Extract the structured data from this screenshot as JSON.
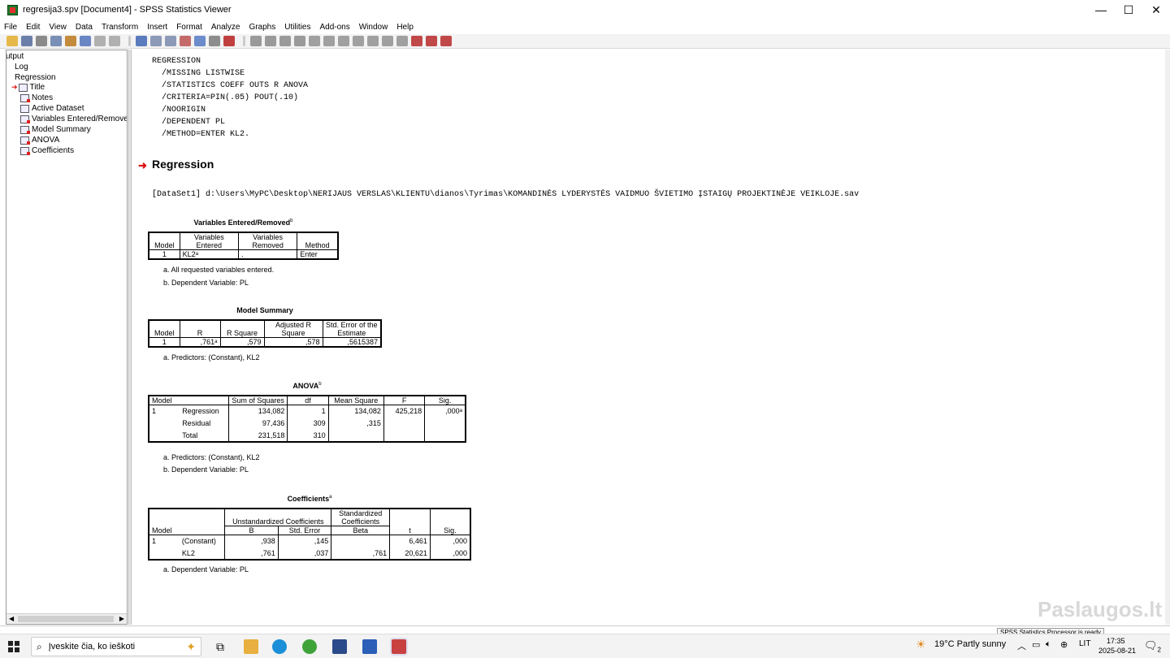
{
  "window": {
    "title": "regresija3.spv [Document4] - SPSS Statistics Viewer",
    "minimize": "—",
    "maximize": "☐",
    "close": "✕"
  },
  "menu": [
    "File",
    "Edit",
    "View",
    "Data",
    "Transform",
    "Insert",
    "Format",
    "Analyze",
    "Graphs",
    "Utilities",
    "Add-ons",
    "Window",
    "Help"
  ],
  "tree": {
    "output": "utput",
    "log": "Log",
    "regression": "Regression",
    "items": [
      "Title",
      "Notes",
      "Active Dataset",
      "Variables Entered/Removed",
      "Model Summary",
      "ANOVA",
      "Coefficients"
    ]
  },
  "syntax": "REGRESSION\n  /MISSING LISTWISE\n  /STATISTICS COEFF OUTS R ANOVA\n  /CRITERIA=PIN(.05) POUT(.10)\n  /NOORIGIN\n  /DEPENDENT PL\n  /METHOD=ENTER KL2.",
  "heading": "Regression",
  "dataset": "[DataSet1] d:\\Users\\MyPC\\Desktop\\NERIJAUS VERSLAS\\KLIENTU\\dianos\\Tyrimas\\KOMANDINĖS LYDERYSTĖS VAIDMUO ŠVIETIMO ĮSTAIGŲ  PROJEKTINĖJE VEIKLOJE.sav",
  "ver": {
    "title": "Variables Entered/Removed",
    "sup": "b",
    "h_model": "Model",
    "h_entered": "Variables Entered",
    "h_removed": "Variables Removed",
    "h_method": "Method",
    "model": "1",
    "entered": "KL2ᵃ",
    "removed": ".",
    "method": "Enter",
    "fn_a": "a. All requested variables entered.",
    "fn_b": "b. Dependent Variable: PL"
  },
  "ms": {
    "title": "Model Summary",
    "h_model": "Model",
    "h_r": "R",
    "h_rsq": "R Square",
    "h_adj": "Adjusted R Square",
    "h_se": "Std. Error of the Estimate",
    "model": "1",
    "r": ",761ᵃ",
    "rsq": ",579",
    "adj": ",578",
    "se": ",5615387",
    "fn_a": "a. Predictors: (Constant), KL2"
  },
  "anova": {
    "title": "ANOVA",
    "sup": "b",
    "h_model": "Model",
    "h_ss": "Sum of Squares",
    "h_df": "df",
    "h_ms": "Mean Square",
    "h_f": "F",
    "h_sig": "Sig.",
    "model": "1",
    "rows": [
      {
        "name": "Regression",
        "ss": "134,082",
        "df": "1",
        "ms": "134,082",
        "f": "425,218",
        "sig": ",000ᵃ"
      },
      {
        "name": "Residual",
        "ss": "97,436",
        "df": "309",
        "ms": ",315",
        "f": "",
        "sig": ""
      },
      {
        "name": "Total",
        "ss": "231,518",
        "df": "310",
        "ms": "",
        "f": "",
        "sig": ""
      }
    ],
    "fn_a": "a. Predictors: (Constant), KL2",
    "fn_b": "b. Dependent Variable: PL"
  },
  "coef": {
    "title": "Coefficients",
    "sup": "a",
    "h_model": "Model",
    "h_unstd": "Unstandardized Coefficients",
    "h_std": "Standardized Coefficients",
    "h_b": "B",
    "h_se": "Std. Error",
    "h_beta": "Beta",
    "h_t": "t",
    "h_sig": "Sig.",
    "model": "1",
    "rows": [
      {
        "name": "(Constant)",
        "b": ",938",
        "se": ",145",
        "beta": "",
        "t": "6,461",
        "sig": ",000"
      },
      {
        "name": "KL2",
        "b": ",761",
        "se": ",037",
        "beta": ",761",
        "t": "20,621",
        "sig": ",000"
      }
    ],
    "fn_a": "a. Dependent Variable: PL"
  },
  "status": "SPSS Statistics Processor is ready",
  "taskbar": {
    "search_placeholder": "Įveskite čia, ko ieškoti",
    "weather": "19°C  Partly sunny",
    "lang": "LIT",
    "time": "17:35",
    "date": "2025-08-21",
    "notif": "2"
  },
  "watermark": "Paslaugos.lt"
}
